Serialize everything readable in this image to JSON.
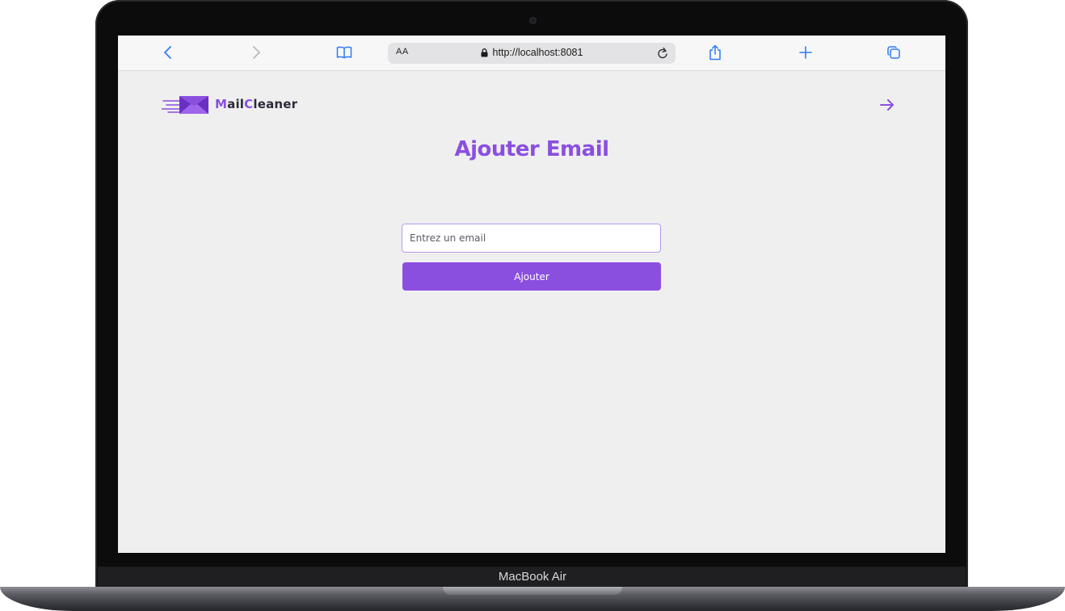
{
  "browser": {
    "text_size_label": "AA",
    "url": "http://localhost:8081"
  },
  "app": {
    "logo": {
      "prefix": "M",
      "mid": "ail",
      "c": "C",
      "suffix": "leaner"
    },
    "page_title": "Ajouter Email",
    "email_placeholder": "Entrez un email",
    "email_value": "",
    "add_button_label": "Ajouter"
  },
  "device": {
    "label": "MacBook Air"
  },
  "colors": {
    "accent": "#8b4fe0",
    "toolbar_icon": "#2f7cf6",
    "page_background": "#efeff0"
  },
  "icons": {
    "back": "chevron-left-icon",
    "forward": "chevron-right-icon",
    "bookmarks": "book-icon",
    "lock": "lock-icon",
    "reload": "reload-icon",
    "share": "share-icon",
    "new_tab": "plus-icon",
    "tabs": "tabs-icon",
    "logo": "envelope-icon",
    "nav": "arrow-right-icon"
  }
}
